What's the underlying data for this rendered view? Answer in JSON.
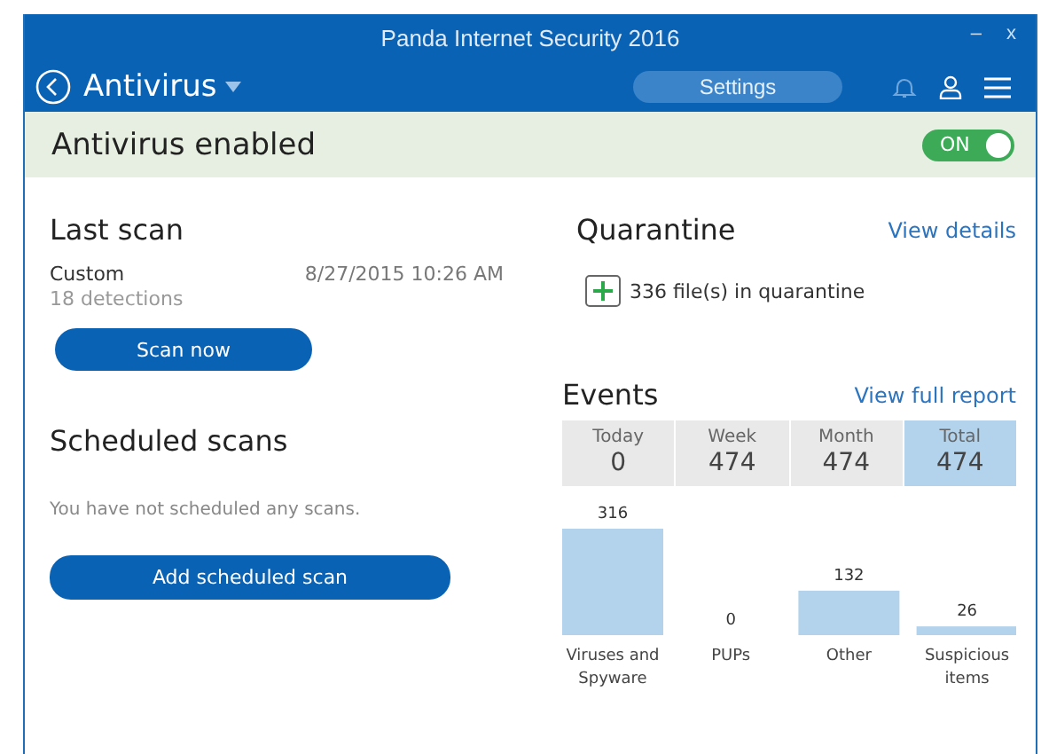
{
  "window": {
    "title": "Panda Internet Security 2016",
    "controls": [
      "–",
      "x"
    ]
  },
  "nav": {
    "section": "Antivirus",
    "settings_button": "Settings"
  },
  "status": {
    "text": "Antivirus enabled",
    "toggle": {
      "label": "ON",
      "on": true
    }
  },
  "last_scan": {
    "title": "Last scan",
    "type": "Custom",
    "date": "8/27/2015 10:26 AM",
    "detections": "18 detections",
    "button": "Scan now"
  },
  "scheduled_scans": {
    "title": "Scheduled scans",
    "message": "You have not scheduled any scans.",
    "button": "Add scheduled scan"
  },
  "quarantine": {
    "title": "Quarantine",
    "link": "View details",
    "files": "336 file(s) in quarantine"
  },
  "events": {
    "title": "Events",
    "link": "View full report",
    "periods": [
      {
        "label": "Today",
        "value": "0",
        "selected": false
      },
      {
        "label": "Week",
        "value": "474",
        "selected": false
      },
      {
        "label": "Month",
        "value": "474",
        "selected": false
      },
      {
        "label": "Total",
        "value": "474",
        "selected": true
      }
    ],
    "chart_data": {
      "type": "bar",
      "categories": [
        "Viruses and Spyware",
        "PUPs",
        "Other",
        "Suspicious items"
      ],
      "series": [
        {
          "color": "#b3d3ec",
          "values": [
            316,
            0,
            132,
            26
          ]
        }
      ],
      "data_labels": true
    }
  }
}
